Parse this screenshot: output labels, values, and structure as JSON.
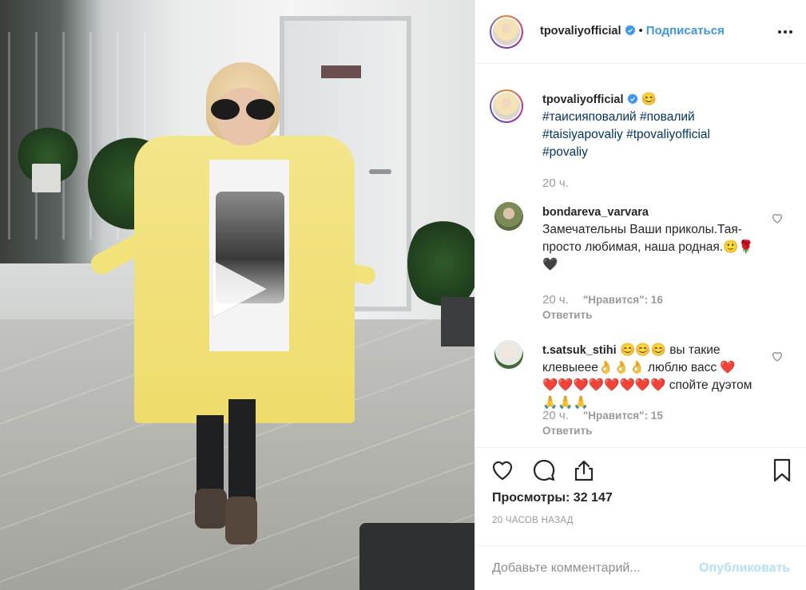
{
  "post": {
    "username": "tpovaliyofficial",
    "follow_label": "Подписаться",
    "separator": "•",
    "caption_username": "tpovaliyofficial",
    "caption_emoji": "😊",
    "hashtags": [
      "#таисияповалий",
      "#повалий",
      "#taisiyapovaliy",
      "#tpovaliyofficial",
      "#povaliy"
    ],
    "caption_time": "20 ч.",
    "views_label": "Просмотры:",
    "views_count": "32 147",
    "date": "20 ЧАСОВ НАЗАД"
  },
  "comments": [
    {
      "username": "bondareva_varvara",
      "text": "Замечательны Ваши приколы.Тая- просто любимая, наша родная.🙂🌹🖤",
      "time": "20 ч.",
      "likes": "\"Нравится\": 16",
      "reply": "Ответить"
    },
    {
      "username": "t.satsuk_stihi",
      "text": "😊😊😊 вы такие клевыеее👌👌👌 люблю васс ❤️ ❤️❤️❤️❤️❤️❤️❤️❤️ спойте дуэтом🙏🙏🙏",
      "time": "20 ч.",
      "likes": "\"Нравится\": 15",
      "reply": "Ответить"
    }
  ],
  "add_comment": {
    "placeholder": "Добавьте комментарий...",
    "publish_label": "Опубликовать"
  },
  "icons": {
    "like": "heart-icon",
    "comment": "comment-icon",
    "share": "share-icon",
    "save": "bookmark-icon",
    "more": "more-icon",
    "play": "play-icon",
    "verified": "verified-icon"
  },
  "colors": {
    "link_blue": "#3897f0",
    "hashtag": "#003569",
    "muted": "#999999",
    "publish_disabled": "#b2dffc",
    "verified": "#3897f0"
  }
}
